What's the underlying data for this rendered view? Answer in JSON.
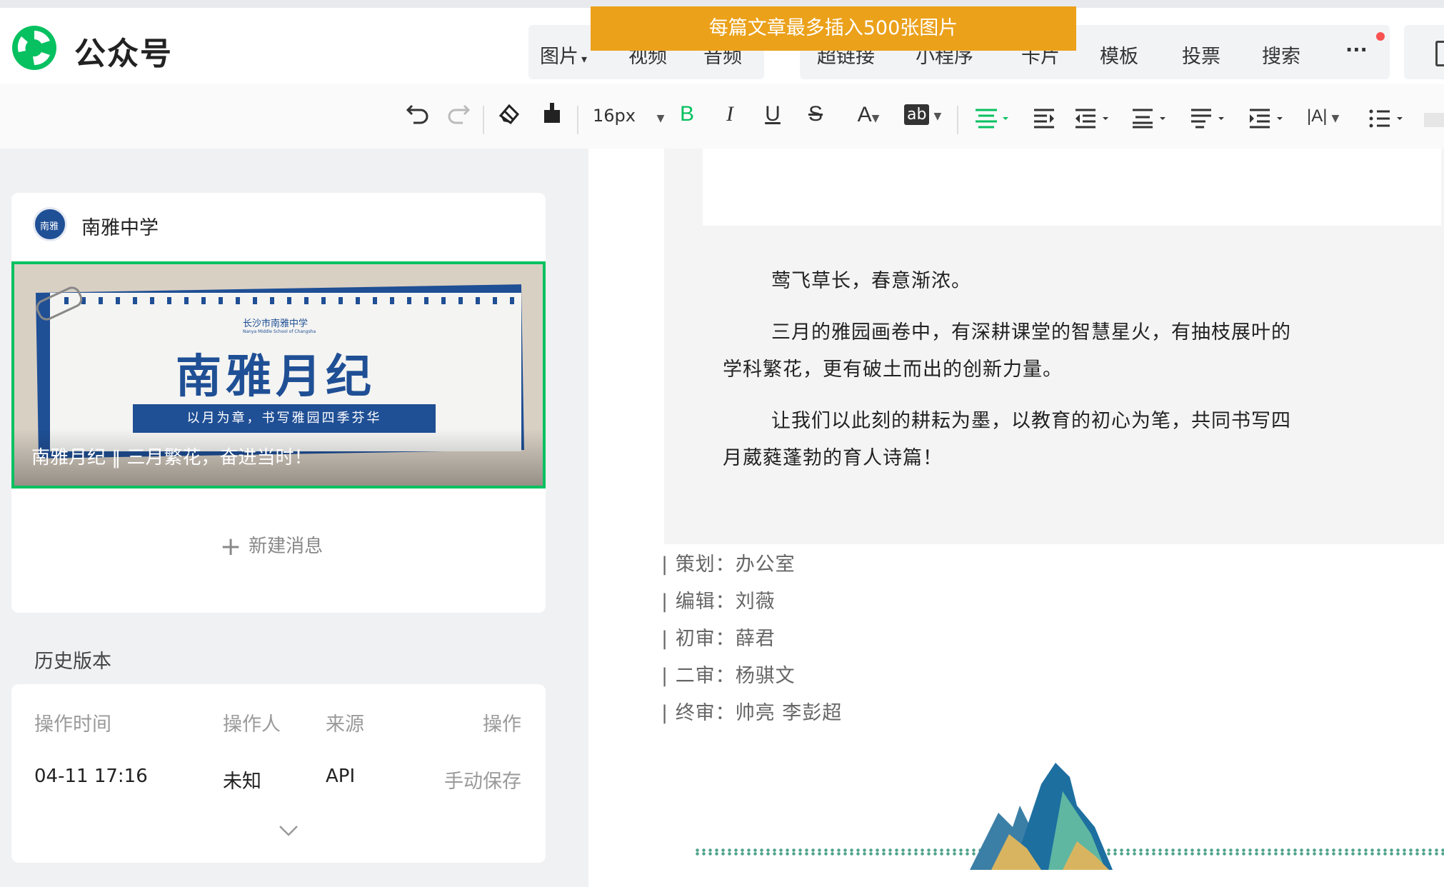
{
  "header": {
    "app_name": "公众号",
    "tabs": [
      "图片",
      "视频",
      "音频",
      "超链接",
      "小程序",
      "卡片",
      "模板",
      "投票",
      "搜索"
    ],
    "tab_dropdown_arrow": "▾",
    "more_label": "···",
    "tooltip": "每篇文章最多插入500张图片"
  },
  "toolbar": {
    "font_size": "16px",
    "bold": "B",
    "italic": "I",
    "underline": "U",
    "strike": "S",
    "font_color": "A",
    "bg_color": "ab",
    "letter_spacing": "|A|"
  },
  "account": {
    "name": "南雅中学",
    "avatar_text": "南雅"
  },
  "cover": {
    "banner_title": "南雅月纪",
    "banner_subtitle": "以月为章，书写雅园四季芬华",
    "school_name": "长沙市南雅中学",
    "school_en": "Nanya Middle School of Changsha",
    "caption": "南雅月纪 ‖ 三月繁花，奋进当时！"
  },
  "new_message": "新建消息",
  "history": {
    "title": "历史版本",
    "columns": [
      "操作时间",
      "操作人",
      "来源",
      "操作"
    ],
    "rows": [
      {
        "time": "04-11 17:16",
        "operator": "未知",
        "source": "API",
        "action": "手动保存"
      }
    ]
  },
  "article": {
    "paragraphs": [
      "莺飞草长，春意渐浓。",
      "三月的雅园画卷中，有深耕课堂的智慧星火，有抽枝展叶的学科繁花，更有破土而出的创新力量。",
      "让我们以此刻的耕耘为墨，以教育的初心为笔，共同书写四月葳蕤蓬勃的育人诗篇！"
    ],
    "credits": [
      {
        "label": "策划：",
        "value": "办公室"
      },
      {
        "label": "编辑：",
        "value": "刘薇"
      },
      {
        "label": "初审：",
        "value": "薛君"
      },
      {
        "label": "二审：",
        "value": "杨骐文"
      },
      {
        "label": "终审：",
        "value": "帅亮 李彭超"
      }
    ]
  },
  "colors": {
    "brand_green": "#07c160",
    "tooltip_orange": "#eba11a",
    "notification_red": "#fa5151",
    "banner_blue": "#1f4f95"
  }
}
